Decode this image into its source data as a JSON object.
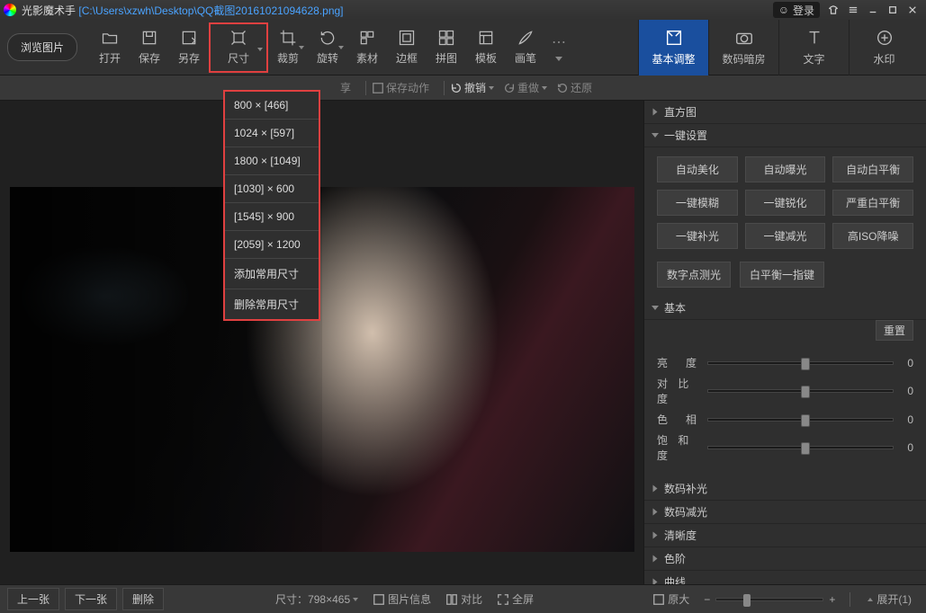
{
  "titlebar": {
    "app_name": "光影魔术手",
    "file_path": "[C:\\Users\\xzwh\\Desktop\\QQ截图20161021094628.png]",
    "login": "登录"
  },
  "toolbar": {
    "browse": "浏览图片",
    "items": [
      "打开",
      "保存",
      "另存",
      "尺寸",
      "裁剪",
      "旋转",
      "素材",
      "边框",
      "拼图",
      "模板",
      "画笔"
    ]
  },
  "right_tabs": [
    "基本调整",
    "数码暗房",
    "文字",
    "水印"
  ],
  "subbar": {
    "share": "享",
    "save_action": "保存动作",
    "undo": "撤销",
    "redo": "重做",
    "restore": "还原"
  },
  "size_dropdown": [
    "800 × [466]",
    "1024 × [597]",
    "1800 × [1049]",
    "[1030] × 600",
    "[1545] × 900",
    "[2059] × 1200",
    "添加常用尺寸",
    "删除常用尺寸"
  ],
  "panel": {
    "histogram": "直方图",
    "one_click": "一键设置",
    "one_click_buttons": [
      "自动美化",
      "自动曝光",
      "自动白平衡",
      "一键模糊",
      "一键锐化",
      "严重白平衡",
      "一键补光",
      "一键减光",
      "高ISO降噪"
    ],
    "extra_buttons": [
      "数字点测光",
      "白平衡一指键"
    ],
    "basic": "基本",
    "reset": "重置",
    "sliders": [
      {
        "label": "亮　度",
        "value": "0",
        "pos": 50
      },
      {
        "label": "对 比 度",
        "value": "0",
        "pos": 50
      },
      {
        "label": "色　相",
        "value": "0",
        "pos": 50
      },
      {
        "label": "饱 和 度",
        "value": "0",
        "pos": 50
      }
    ],
    "closed_sections": [
      "数码补光",
      "数码减光",
      "清晰度",
      "色阶",
      "曲线"
    ]
  },
  "statusbar": {
    "prev": "上一张",
    "next": "下一张",
    "delete": "删除",
    "size_label": "尺寸：",
    "size_value": "798×465",
    "info": "图片信息",
    "compare": "对比",
    "fullscreen": "全屏",
    "original": "原大",
    "expand": "展开(1)"
  }
}
